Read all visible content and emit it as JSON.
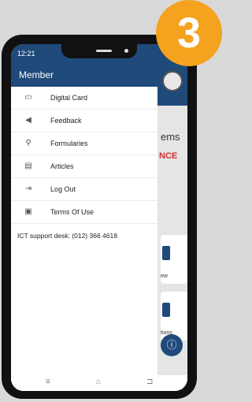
{
  "status_bar": {
    "time": "12:21"
  },
  "badge": {
    "number": "3"
  },
  "drawer": {
    "title": "Member",
    "items": [
      {
        "label": "Digital Card",
        "icon": "card-icon"
      },
      {
        "label": "Feedback",
        "icon": "megaphone-icon"
      },
      {
        "label": "Formularies",
        "icon": "search-icon"
      },
      {
        "label": "Articles",
        "icon": "articles-icon"
      },
      {
        "label": "Log Out",
        "icon": "logout-icon"
      },
      {
        "label": "Terms Of Use",
        "icon": "book-icon"
      }
    ],
    "support_text": "ICT support desk: (012) 366 4618"
  },
  "background_app": {
    "brand_fragment": "ems",
    "banner_fragment": "NCE",
    "card1_label": "ew",
    "card2_label": "tions"
  },
  "colors": {
    "primary": "#1f4a7a",
    "badge": "#f5a21f",
    "accent_red": "#d12c2c"
  }
}
